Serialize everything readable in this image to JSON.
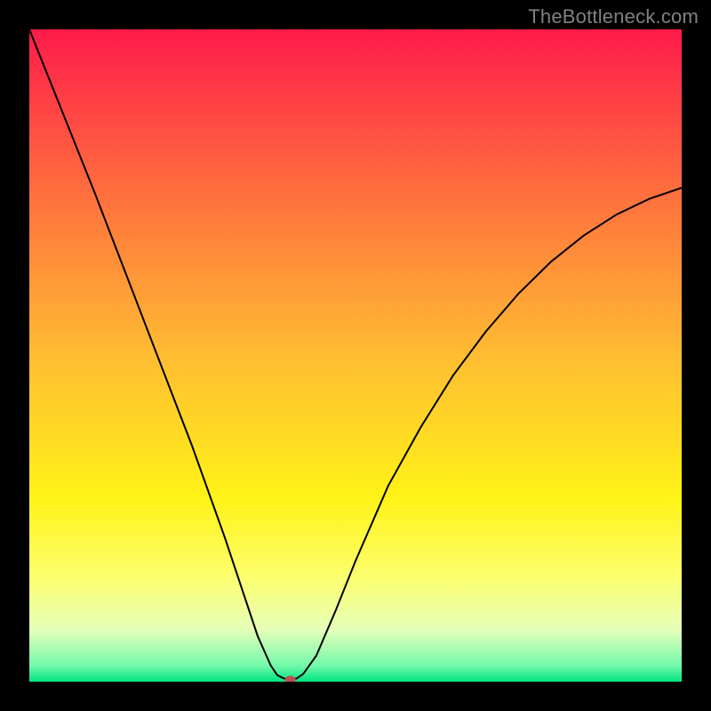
{
  "watermark": {
    "text": "TheBottleneck.com"
  },
  "chart_data": {
    "type": "line",
    "title": "",
    "xlabel": "",
    "ylabel": "",
    "xlim": [
      0,
      100
    ],
    "ylim": [
      0,
      100
    ],
    "grid": false,
    "legend": null,
    "background_gradient": {
      "stops": [
        {
          "pos": 0.0,
          "color": "#ff1b4b"
        },
        {
          "pos": 0.25,
          "color": "#ff6f3e"
        },
        {
          "pos": 0.5,
          "color": "#ffbc32"
        },
        {
          "pos": 0.72,
          "color": "#fff317"
        },
        {
          "pos": 0.84,
          "color": "#fcff6f"
        },
        {
          "pos": 0.92,
          "color": "#e6ffb8"
        },
        {
          "pos": 0.975,
          "color": "#74f9ab"
        },
        {
          "pos": 1.0,
          "color": "#00e583"
        }
      ]
    },
    "series": [
      {
        "name": "bottleneck-curve",
        "color": "#000000",
        "x": [
          0,
          5,
          10,
          15,
          20,
          25,
          30,
          33,
          35,
          37,
          38,
          39,
          40,
          41,
          42,
          44,
          47,
          50,
          55,
          60,
          65,
          70,
          75,
          80,
          85,
          90,
          95,
          100
        ],
        "y": [
          100,
          87.5,
          75,
          62,
          49,
          36,
          22,
          13,
          7,
          2.5,
          1.0,
          0.5,
          0.3,
          0.5,
          1.2,
          4,
          11,
          18.5,
          30,
          39,
          47,
          53.7,
          59.5,
          64.4,
          68.4,
          71.6,
          74.0,
          75.7
        ]
      }
    ],
    "marker": {
      "name": "optimal-point",
      "x": 40,
      "y": 0.3,
      "color": "#c05050",
      "rx": 6,
      "ry": 4.5
    }
  }
}
